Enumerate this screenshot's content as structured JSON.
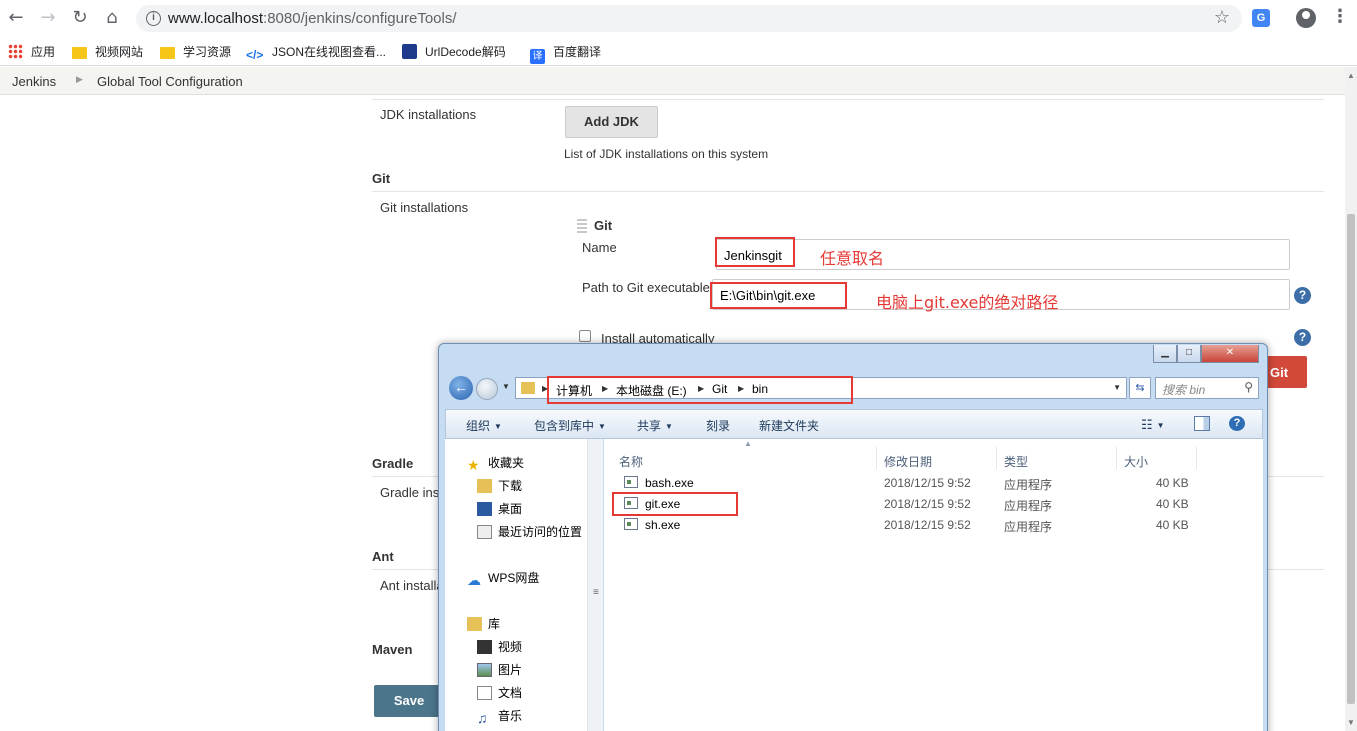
{
  "browser": {
    "url_host": "www.localhost",
    "url_path": ":8080/jenkins/configureTools/",
    "bookmarks": [
      "应用",
      "视频网站",
      "学习资源",
      "JSON在线视图查看...",
      "UrlDecode解码",
      "百度翻译"
    ]
  },
  "breadcrumbs": [
    "Jenkins",
    "Global Tool Configuration"
  ],
  "jdk": {
    "label": "JDK installations",
    "add_button": "Add JDK",
    "help": "List of JDK installations on this system"
  },
  "git": {
    "section_title": "Git",
    "installations_label": "Git installations",
    "item_title": "Git",
    "name_label": "Name",
    "name_value": "Jenkinsgit",
    "path_label": "Path to Git executable",
    "path_value": "E:\\Git\\bin\\git.exe",
    "install_auto_label": "Install automatically",
    "red_button_fragment": "Git"
  },
  "gradle": {
    "section_title": "Gradle",
    "installations_label": "Gradle ins"
  },
  "ant": {
    "section_title": "Ant",
    "installations_label": "Ant installa"
  },
  "maven": {
    "section_title": "Maven"
  },
  "save_button": "Save",
  "annotations": {
    "name_note": "任意取名",
    "path_note": "电脑上git.exe的绝对路径"
  },
  "explorer": {
    "path": [
      "计算机",
      "本地磁盘 (E:)",
      "Git",
      "bin"
    ],
    "search_placeholder": "搜索 bin",
    "commands": [
      "组织",
      "包含到库中",
      "共享",
      "刻录",
      "新建文件夹"
    ],
    "nav": {
      "favorites": "收藏夹",
      "downloads": "下载",
      "desktop": "桌面",
      "recent": "最近访问的位置",
      "wps": "WPS网盘",
      "libraries": "库",
      "videos": "视频",
      "pictures": "图片",
      "documents": "文档",
      "music": "音乐"
    },
    "columns": [
      "名称",
      "修改日期",
      "类型",
      "大小"
    ],
    "files": [
      {
        "name": "bash.exe",
        "modified": "2018/12/15 9:52",
        "type": "应用程序",
        "size": "40 KB"
      },
      {
        "name": "git.exe",
        "modified": "2018/12/15 9:52",
        "type": "应用程序",
        "size": "40 KB"
      },
      {
        "name": "sh.exe",
        "modified": "2018/12/15 9:52",
        "type": "应用程序",
        "size": "40 KB"
      }
    ]
  },
  "colors": {
    "annotation_red": "#e53935",
    "save_button": "#4b758b",
    "jenkins_red": "#d24939",
    "help_icon": "#3d6ea8"
  }
}
